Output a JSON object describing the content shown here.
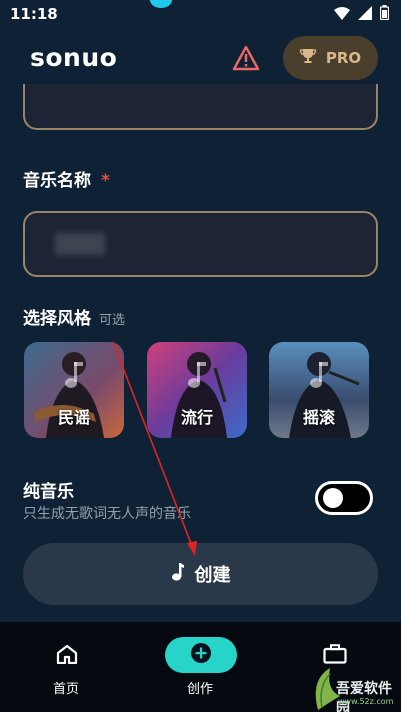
{
  "status_bar": {
    "time": "11:18",
    "icons": [
      "wifi-icon",
      "signal-icon",
      "battery-icon"
    ]
  },
  "header": {
    "app_name": "sonuo",
    "pro_label": "PRO",
    "icons": [
      "warning-icon",
      "trophy-icon"
    ]
  },
  "form": {
    "music_name": {
      "label": "音乐名称",
      "required_mark": "*"
    },
    "style": {
      "label": "选择风格",
      "optional_hint": "可选",
      "options": [
        {
          "label": "民谣"
        },
        {
          "label": "流行"
        },
        {
          "label": "摇滚"
        }
      ]
    },
    "pure_music": {
      "title": "纯音乐",
      "description": "只生成无歌词无人声的音乐",
      "enabled": false
    },
    "create_button": {
      "label": "创建",
      "icon": "music-note-icon"
    }
  },
  "bottom_nav": {
    "items": [
      {
        "label": "首页",
        "icon": "home-icon"
      },
      {
        "label": "创作",
        "icon": "plus-circle-icon"
      },
      {
        "label": "",
        "icon": "briefcase-icon"
      }
    ]
  },
  "watermark": {
    "text": "吾爱软件园",
    "url": "www.52z.com"
  },
  "colors": {
    "background": "#0f2235",
    "field_border": "#9a8466",
    "pro_bg": "#4a3f2c",
    "pro_text": "#d8b888",
    "accent_teal": "#27d5c8",
    "required": "#e54b4b",
    "annotation": "#e02424"
  }
}
